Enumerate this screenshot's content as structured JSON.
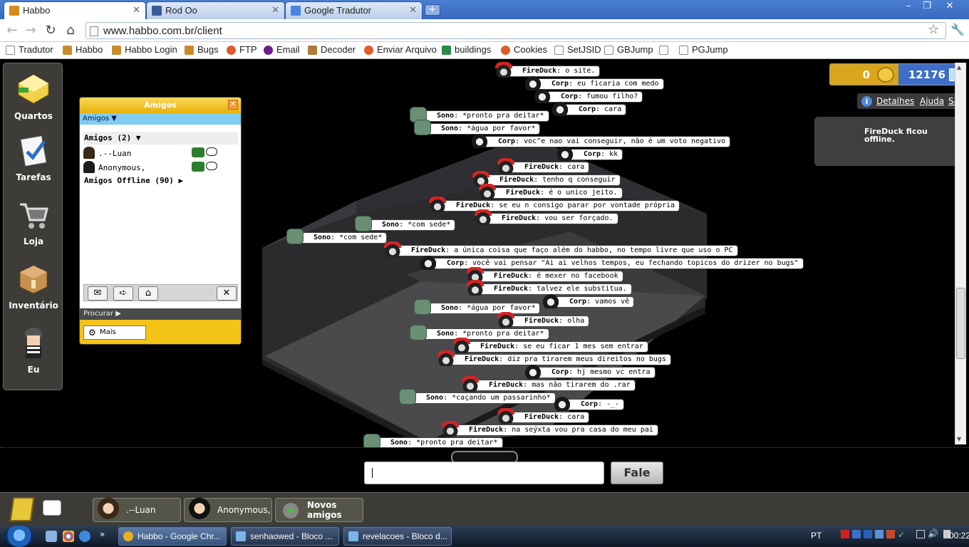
{
  "browser": {
    "tabs": [
      {
        "title": "Habbo",
        "active": true,
        "icon_color": "#d58a1c"
      },
      {
        "title": "Rod Oo",
        "active": false,
        "icon_color": "#3b5998"
      },
      {
        "title": "Google Tradutor",
        "active": false,
        "icon_color": "#4a84e0"
      }
    ],
    "url": "www.habbo.com.br/client",
    "bookmarks": [
      {
        "label": "Tradutor",
        "icon": "page-icon"
      },
      {
        "label": "Habbo",
        "icon": "habbo-icon"
      },
      {
        "label": "Habbo Login",
        "icon": "habbo-icon"
      },
      {
        "label": "Bugs",
        "icon": "habbo-icon"
      },
      {
        "label": "FTP",
        "icon": "ftp-icon"
      },
      {
        "label": "Email",
        "icon": "yahoo-icon"
      },
      {
        "label": "Decoder",
        "icon": "decoder-icon"
      },
      {
        "label": "Enviar Arquivo",
        "icon": "upload-icon"
      },
      {
        "label": "buildings",
        "icon": "buildings-icon"
      },
      {
        "label": "Cookies",
        "icon": "cookies-icon"
      },
      {
        "label": "SetJSID",
        "icon": "page-icon"
      },
      {
        "label": "GBJump",
        "icon": "page-icon"
      },
      {
        "label": "",
        "icon": "page-icon"
      },
      {
        "label": "PGJump",
        "icon": "page-icon"
      }
    ]
  },
  "nav": {
    "items": [
      {
        "label": "Quartos",
        "icon": "rooms-icon"
      },
      {
        "label": "Tarefas",
        "icon": "quests-icon"
      },
      {
        "label": "Loja",
        "icon": "shop-cart-icon"
      },
      {
        "label": "Inventário",
        "icon": "inventory-box-icon"
      },
      {
        "label": "Eu",
        "icon": "avatar-icon"
      }
    ]
  },
  "friends": {
    "title": "Amigos",
    "tab_label": "Amigos",
    "group_label": "Amigos (2)",
    "online": [
      {
        "name": ".--Luan"
      },
      {
        "name": "Anonymous,"
      }
    ],
    "offline_label": "Amigos Offline (90)",
    "search_label": "Procurar",
    "more_label": "Mais"
  },
  "wallet": {
    "credits": "0",
    "pixels": "12176"
  },
  "user_links": {
    "details": "Detalhes",
    "help": "Ajuda",
    "logout": "Sair"
  },
  "notification": {
    "line1": "FireDuck ficou",
    "line2": "offline."
  },
  "chat": [
    {
      "user": "FireDuck",
      "text": "o site.",
      "type": "fire"
    },
    {
      "user": "Corp",
      "text": "eu ficaria com medo",
      "type": "corp"
    },
    {
      "user": "Corp",
      "text": "fumou filho?",
      "type": "corp"
    },
    {
      "user": "Corp",
      "text": "cara",
      "type": "corp"
    },
    {
      "user": "Sono",
      "text": "*pronto pra deitar*",
      "type": "sono"
    },
    {
      "user": "Sono",
      "text": "*água por favor*",
      "type": "sono"
    },
    {
      "user": "Corp",
      "text": "voc^e nao vai conseguir, não é um voto negativo",
      "type": "corp"
    },
    {
      "user": "Corp",
      "text": "kk",
      "type": "corp"
    },
    {
      "user": "FireDuck",
      "text": "cara",
      "type": "fire"
    },
    {
      "user": "FireDuck",
      "text": "tenho q conseguir",
      "type": "fire"
    },
    {
      "user": "FireDuck",
      "text": "é o unico jeito.",
      "type": "fire"
    },
    {
      "user": "FireDuck",
      "text": "se eu n consigo parar por vontade própria",
      "type": "fire"
    },
    {
      "user": "FireDuck",
      "text": "vou ser forçado.",
      "type": "fire"
    },
    {
      "user": "Sono",
      "text": "*com sede*",
      "type": "sono"
    },
    {
      "user": "Sono",
      "text": "*com sede*",
      "type": "sono"
    },
    {
      "user": "FireDuck",
      "text": "a única coisa que faço além do habbo, no tempo livre que uso o PC",
      "type": "fire"
    },
    {
      "user": "Corp",
      "text": "você vai pensar \"Ai ai velhos tempos, eu fechando topicos do drizer no bugs\"",
      "type": "corp"
    },
    {
      "user": "FireDuck",
      "text": "é mexer no facebook",
      "type": "fire"
    },
    {
      "user": "FireDuck",
      "text": "talvez ele substitua.",
      "type": "fire"
    },
    {
      "user": "Corp",
      "text": "vamos vê",
      "type": "corp"
    },
    {
      "user": "Sono",
      "text": "*água por favor*",
      "type": "sono"
    },
    {
      "user": "FireDuck",
      "text": "olha",
      "type": "fire"
    },
    {
      "user": "Sono",
      "text": "*pronto pra deitar*",
      "type": "sono"
    },
    {
      "user": "FireDuck",
      "text": "se eu ficar 1 mes sem entrar",
      "type": "fire"
    },
    {
      "user": "FireDuck",
      "text": "diz pra tirarem meus direitos no bugs",
      "type": "fire"
    },
    {
      "user": "Corp",
      "text": "hj mesmo vc entra",
      "type": "corp"
    },
    {
      "user": "FireDuck",
      "text": "mas não tirarem do .rar",
      "type": "fire"
    },
    {
      "user": "Sono",
      "text": "*caçando um passarinho*",
      "type": "sono"
    },
    {
      "user": "Corp",
      "text": "-_-",
      "type": "corp"
    },
    {
      "user": "FireDuck",
      "text": "cara",
      "type": "fire"
    },
    {
      "user": "FireDuck",
      "text": "na seýxta vou pra casa do meu pai",
      "type": "fire"
    },
    {
      "user": "Sono",
      "text": "*pronto pra deitar*",
      "type": "sono"
    }
  ],
  "speak_button": "Fale",
  "bottom_bar": [
    {
      "label": ".--Luan"
    },
    {
      "label": "Anonymous,"
    },
    {
      "label": "Novos amigos"
    }
  ],
  "taskbar": {
    "tasks": [
      {
        "title": "Habbo - Google Chr...",
        "active": true,
        "icon_color": "#e8b020"
      },
      {
        "title": "senhaowed - Bloco ...",
        "active": false,
        "icon_color": "#7ab4e8"
      },
      {
        "title": "revelacoes - Bloco d...",
        "active": false,
        "icon_color": "#7ab4e8"
      }
    ],
    "language": "PT",
    "clock": "00:22"
  }
}
